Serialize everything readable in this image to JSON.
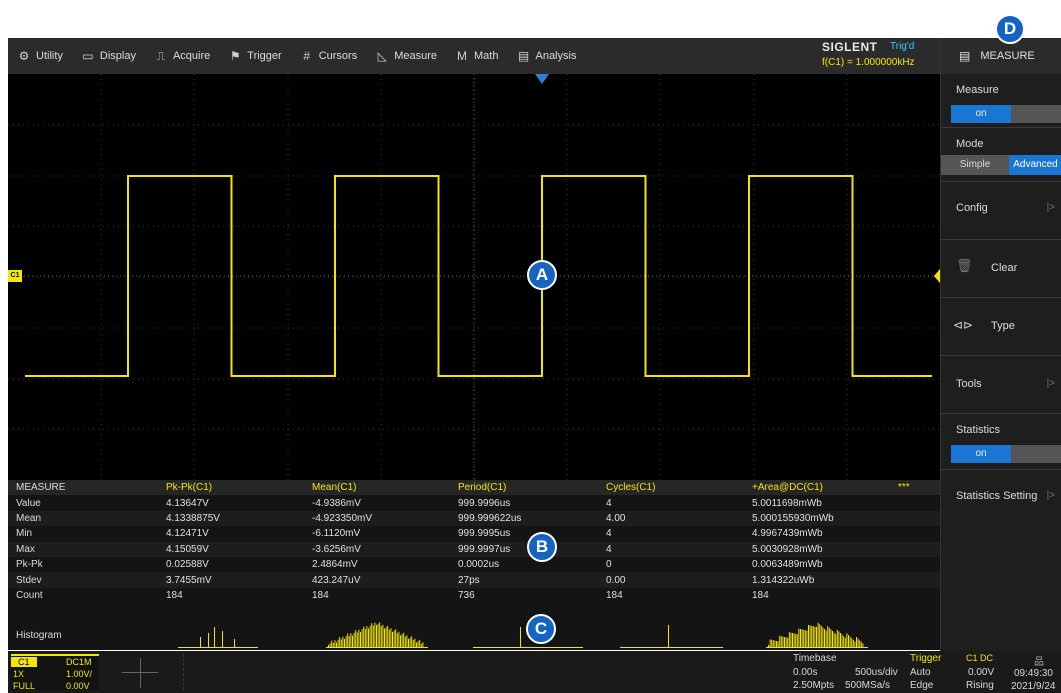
{
  "menu": [
    {
      "icon": "gear-icon",
      "glyph": "⚙",
      "label": "Utility"
    },
    {
      "icon": "display-icon",
      "glyph": "▭",
      "label": "Display"
    },
    {
      "icon": "acquire-icon",
      "glyph": "⎍",
      "label": "Acquire"
    },
    {
      "icon": "flag-icon",
      "glyph": "⚑",
      "label": "Trigger"
    },
    {
      "icon": "cursors-icon",
      "glyph": "#",
      "label": "Cursors"
    },
    {
      "icon": "measure-icon",
      "glyph": "◺",
      "label": "Measure"
    },
    {
      "icon": "math-icon",
      "glyph": "M",
      "label": "Math"
    },
    {
      "icon": "analysis-icon",
      "glyph": "▤",
      "label": "Analysis"
    }
  ],
  "brand": {
    "logo": "SIGLENT",
    "status": "Trig'd",
    "frequency": "f(C1) = 1.000000kHz"
  },
  "panel": {
    "title": "MEASURE",
    "measure_label": "Measure",
    "measure_state": "on",
    "mode_label": "Mode",
    "mode_simple": "Simple",
    "mode_advanced": "Advanced",
    "config": "Config",
    "clear": "Clear",
    "type": "Type",
    "tools": "Tools",
    "statistics_label": "Statistics",
    "statistics_state": "on",
    "statistics_setting": "Statistics Setting"
  },
  "callouts": {
    "a": "A",
    "b": "B",
    "c": "C",
    "d": "D"
  },
  "channel_marker": "C1",
  "table": {
    "title": "MEASURE",
    "columns": [
      "Pk-Pk(C1)",
      "Mean(C1)",
      "Period(C1)",
      "Cycles(C1)",
      "+Area@DC(C1)"
    ],
    "more": "***",
    "rows": [
      {
        "label": "Value",
        "cells": [
          "4.13647V",
          "-4.9386mV",
          "999.9996us",
          "4",
          "5.0011698mWb"
        ]
      },
      {
        "label": "Mean",
        "cells": [
          "4.1338875V",
          "-4.923350mV",
          "999.999622us",
          "4.00",
          "5.000155930mWb"
        ]
      },
      {
        "label": "Min",
        "cells": [
          "4.12471V",
          "-6.1120mV",
          "999.9995us",
          "4",
          "4.9967439mWb"
        ]
      },
      {
        "label": "Max",
        "cells": [
          "4.15059V",
          "-3.6256mV",
          "999.9997us",
          "4",
          "5.0030928mWb"
        ]
      },
      {
        "label": "Pk-Pk",
        "cells": [
          "0.02588V",
          "2.4864mV",
          "0.0002us",
          "0",
          "0.0063489mWb"
        ]
      },
      {
        "label": "Stdev",
        "cells": [
          "3.7455mV",
          "423.247uV",
          "27ps",
          "0.00",
          "1.314322uWb"
        ]
      },
      {
        "label": "Count",
        "cells": [
          "184",
          "184",
          "736",
          "184",
          "184"
        ]
      }
    ]
  },
  "histogram_label": "Histogram",
  "status": {
    "ch1": {
      "name": "C1",
      "coupling": "DC1M",
      "probe": "1X",
      "scale": "1.00V/",
      "bw": "FULL",
      "offset": "0.00V"
    },
    "timebase": {
      "title": "Timebase",
      "delay": "0.00s",
      "scale": "500us/div",
      "points": "2.50Mpts",
      "rate": "500MSa/s"
    },
    "trigger": {
      "title": "Trigger",
      "source": "C1 DC",
      "mode": "Auto",
      "level": "0.00V",
      "type": "Edge",
      "slope": "Rising"
    },
    "time": "09:49:30",
    "date": "2021/9/24"
  },
  "colors": {
    "trace": "#f5e600",
    "accent": "#1976d2",
    "background": "#000000"
  }
}
